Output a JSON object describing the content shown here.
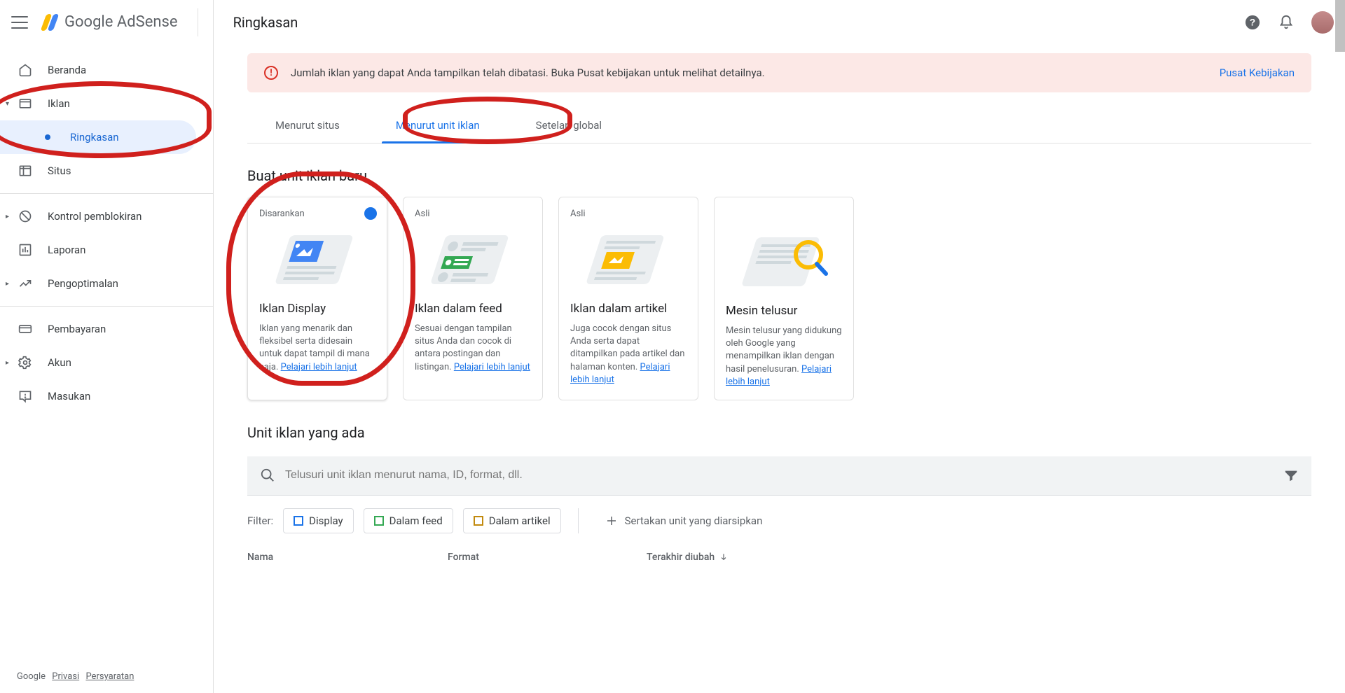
{
  "header": {
    "logo_text": "Google AdSense",
    "page_title": "Ringkasan"
  },
  "sidebar": {
    "items": [
      {
        "label": "Beranda"
      },
      {
        "label": "Iklan"
      },
      {
        "label": "Ringkasan"
      },
      {
        "label": "Situs"
      },
      {
        "label": "Kontrol pemblokiran"
      },
      {
        "label": "Laporan"
      },
      {
        "label": "Pengoptimalan"
      },
      {
        "label": "Pembayaran"
      },
      {
        "label": "Akun"
      },
      {
        "label": "Masukan"
      }
    ],
    "footer_brand": "Google",
    "footer_privacy": "Privasi",
    "footer_terms": "Persyaratan"
  },
  "alert": {
    "text": "Jumlah iklan yang dapat Anda tampilkan telah dibatasi. Buka Pusat kebijakan untuk melihat detailnya.",
    "cta": "Pusat Kebijakan"
  },
  "tabs": [
    {
      "label": "Menurut situs"
    },
    {
      "label": "Menurut unit iklan"
    },
    {
      "label": "Setelan global"
    }
  ],
  "section_new": "Buat unit iklan baru",
  "cards": [
    {
      "badge": "Disarankan",
      "title": "Iklan Display",
      "desc": "Iklan yang menarik dan fleksibel serta didesain untuk dapat tampil di mana saja. ",
      "link": "Pelajari lebih lanjut"
    },
    {
      "badge": "Asli",
      "title": "Iklan dalam feed",
      "desc": "Sesuai dengan tampilan situs Anda dan cocok di antara postingan dan listingan. ",
      "link": "Pelajari lebih lanjut"
    },
    {
      "badge": "Asli",
      "title": "Iklan dalam artikel",
      "desc": "Juga cocok dengan situs Anda serta dapat ditampilkan pada artikel dan halaman konten. ",
      "link": "Pelajari lebih lanjut"
    },
    {
      "badge": "",
      "title": "Mesin telusur",
      "desc": "Mesin telusur yang didukung oleh Google yang menampilkan iklan dengan hasil penelusuran. ",
      "link": "Pelajari lebih lanjut"
    }
  ],
  "section_existing": "Unit iklan yang ada",
  "search_placeholder": "Telusuri unit iklan menurut nama, ID, format, dll.",
  "filter": {
    "label": "Filter:",
    "chips": [
      {
        "label": "Display"
      },
      {
        "label": "Dalam feed"
      },
      {
        "label": "Dalam artikel"
      }
    ],
    "archive": "Sertakan unit yang diarsipkan"
  },
  "table": {
    "col1": "Nama",
    "col2": "Format",
    "col3": "Terakhir diubah"
  }
}
